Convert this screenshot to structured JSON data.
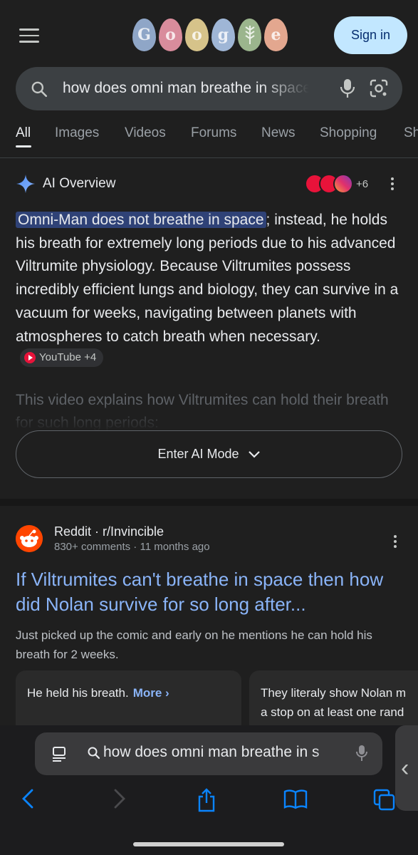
{
  "header": {
    "logo_letters": [
      "G",
      "o",
      "o",
      "g",
      "",
      "e"
    ],
    "logo_colors": [
      "#8fa6c7",
      "#d98c9c",
      "#d6c38a",
      "#9fb6d6",
      "#9bb58d",
      "#e3a78f"
    ],
    "sign_in_label": "Sign in"
  },
  "search": {
    "query": "how does omni man breathe in space"
  },
  "tabs": [
    "All",
    "Images",
    "Videos",
    "Forums",
    "News",
    "Shopping",
    "Sh"
  ],
  "ai_overview": {
    "title": "AI Overview",
    "sources_more": "+6",
    "highlight": "Omni-Man does not breathe in space",
    "body": "; instead, he holds his breath for extremely long periods due to his advanced Viltrumite physiology. Because Viltrumites possess incredibly efficient lungs and biology, they can survive in a vacuum for weeks, navigating between planets with atmospheres to catch breath when necessary.",
    "source_chip": "YouTube +4",
    "faded_text": "This video explains how Viltrumites can hold their breath for such long periods:",
    "enter_ai_mode": "Enter AI Mode"
  },
  "result": {
    "site": "Reddit · r/Invincible",
    "meta": "830+ comments · 11 months ago",
    "title": "If Viltrumites can't breathe in space then how did Nolan survive for so long after...",
    "snippet": "Just picked up the comic and early on he mentions he can hold his breath for 2 weeks.",
    "card1_text": "He held his breath.",
    "card1_more": "More",
    "card2_line1": "They literaly show Nolan m",
    "card2_line2": "a stop on at least one rand"
  },
  "safari": {
    "url_text": "how does omni man breathe in s",
    "accent": "#0a84ff"
  },
  "colors": {
    "background": "#1f1f1f",
    "link": "#8ab4f8",
    "highlight": "#2f4277",
    "sign_in_bg": "#c2e7ff"
  }
}
